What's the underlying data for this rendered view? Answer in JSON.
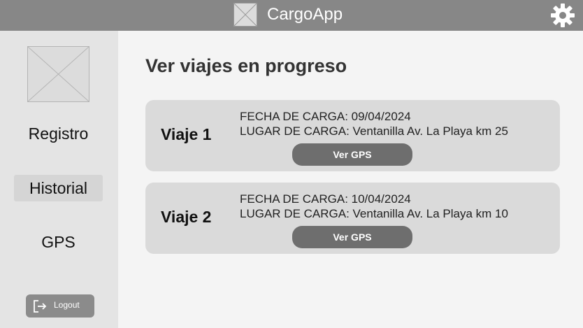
{
  "header": {
    "app_title": "CargoApp",
    "logo_icon": "image-placeholder-icon",
    "settings_icon": "gear-icon"
  },
  "sidebar": {
    "avatar_icon": "image-placeholder-icon",
    "items": [
      {
        "label": "Registro",
        "active": false
      },
      {
        "label": "Historial",
        "active": true
      },
      {
        "label": "GPS",
        "active": false
      }
    ],
    "logout": {
      "label": "Logout",
      "icon": "logout-icon"
    }
  },
  "main": {
    "title": "Ver viajes en progreso",
    "trips": [
      {
        "title": "Viaje 1",
        "fecha": "FECHA DE CARGA: 09/04/2024",
        "lugar": "LUGAR DE CARGA: Ventanilla Av. La Playa km 25",
        "button": "Ver GPS"
      },
      {
        "title": "Viaje 2",
        "fecha": "FECHA DE CARGA: 10/04/2024",
        "lugar": "LUGAR DE CARGA: Ventanilla Av. La Playa km 10",
        "button": "Ver GPS"
      }
    ]
  },
  "colors": {
    "header_bg": "#878787",
    "sidebar_bg": "#e4e4e4",
    "card_bg": "#dadada",
    "button_bg": "#6e6e6e"
  }
}
